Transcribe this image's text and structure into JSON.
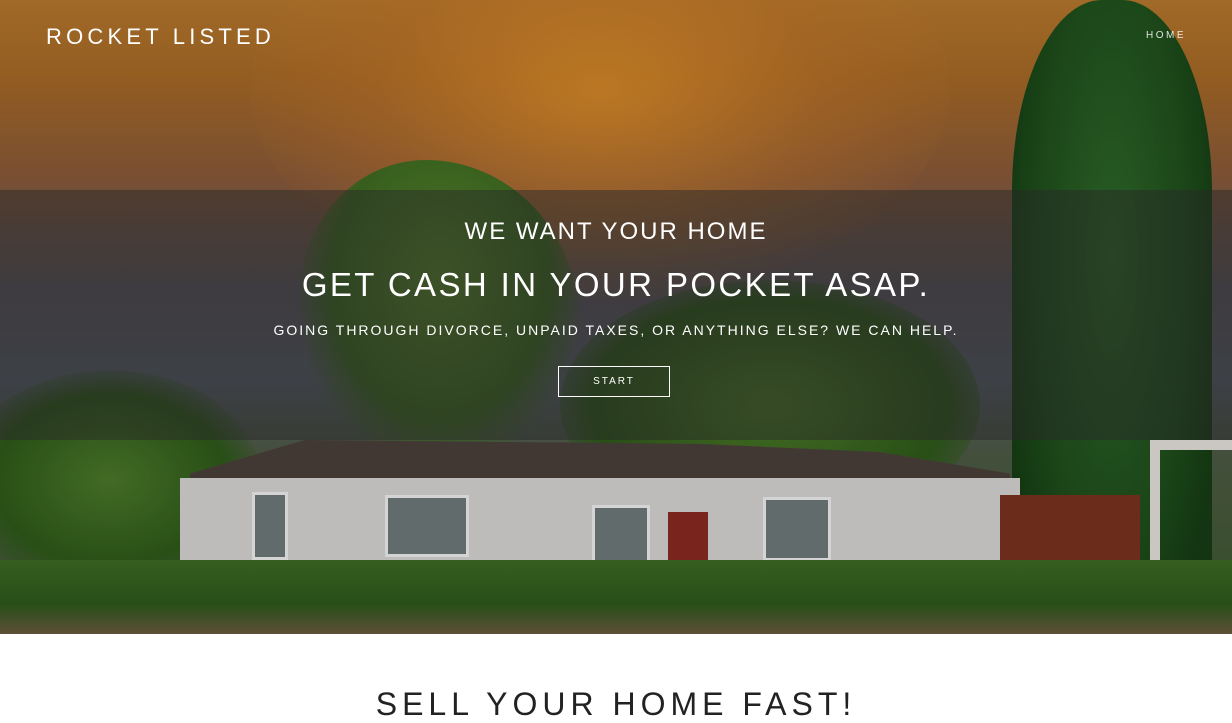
{
  "header": {
    "brand": "ROCKET LISTED",
    "nav": [
      {
        "label": "HOME"
      }
    ]
  },
  "hero": {
    "headline_small": "WE WANT YOUR HOME",
    "headline_large": "GET CASH IN YOUR POCKET ASAP.",
    "subline": "GOING THROUGH DIVORCE, UNPAID TAXES, OR ANYTHING ELSE? WE CAN HELP.",
    "cta_label": "START",
    "background_image": "house-with-trees-sunset-photo"
  },
  "section": {
    "title": "SELL YOUR HOME FAST!"
  },
  "colors": {
    "text_on_hero": "#ffffff",
    "overlay_band": "#282828",
    "section_title": "#222222"
  }
}
